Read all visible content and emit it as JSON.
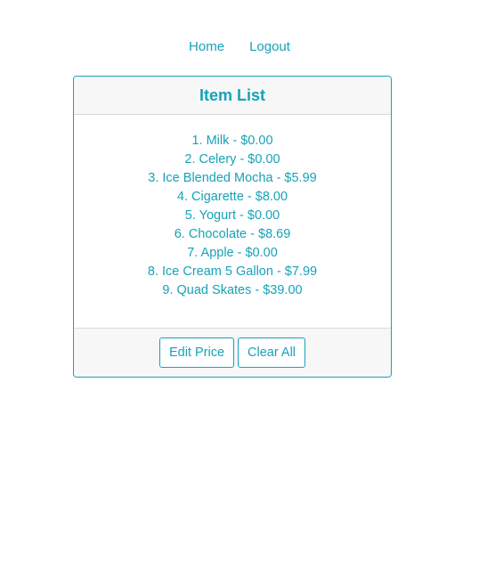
{
  "nav": {
    "home_label": "Home",
    "logout_label": "Logout"
  },
  "card": {
    "title": "Item List",
    "items": [
      "1. Milk - $0.00",
      "2. Celery - $0.00",
      "3. Ice Blended Mocha - $5.99",
      "4. Cigarette - $8.00",
      "5. Yogurt - $0.00",
      "6. Chocolate - $8.69",
      "7. Apple - $0.00",
      "8. Ice Cream 5 Gallon - $7.99",
      "9. Quad Skates - $39.00"
    ],
    "footer": {
      "edit_price_label": "Edit Price",
      "clear_all_label": "Clear All"
    }
  },
  "colors": {
    "accent": "#17a2b8",
    "header_bg": "#f7f7f7",
    "divider": "#d9d9d9"
  }
}
